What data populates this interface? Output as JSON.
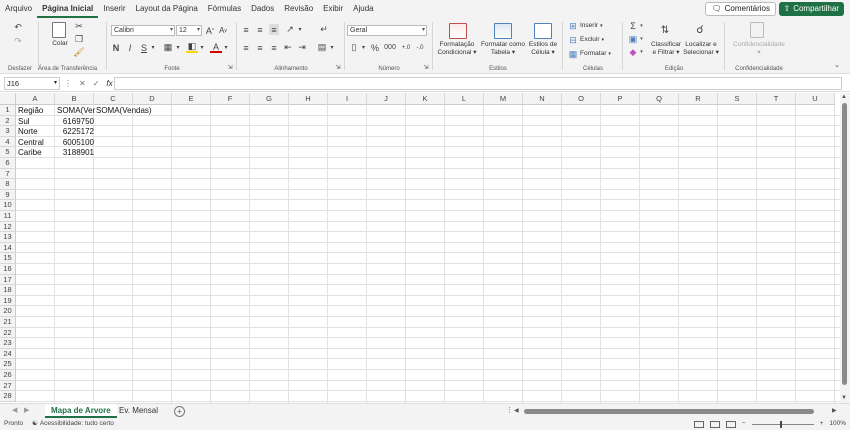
{
  "menu": {
    "items": [
      "Arquivo",
      "Página Inicial",
      "Inserir",
      "Layout da Página",
      "Fórmulas",
      "Dados",
      "Revisão",
      "Exibir",
      "Ajuda"
    ],
    "active_index": 1,
    "comments_label": "Comentários",
    "share_label": "Compartilhar"
  },
  "ribbon": {
    "undo_group_label": "Desfazer",
    "clipboard": {
      "paste_label": "Colar",
      "group_label": "Área de Transferência"
    },
    "font": {
      "family": "Calibri",
      "size": "12",
      "bold": "N",
      "italic": "I",
      "underline": "S",
      "group_label": "Fonte"
    },
    "alignment": {
      "group_label": "Alinhamento"
    },
    "number": {
      "format": "Geral",
      "group_label": "Número"
    },
    "styles": {
      "conditional_line1": "Formatação",
      "conditional_line2": "Condicional",
      "table_line1": "Formatar como",
      "table_line2": "Tabela",
      "cell_styles_line1": "Estilos de",
      "cell_styles_line2": "Célula",
      "group_label": "Estilos"
    },
    "cells": {
      "insert": "Inserir",
      "delete": "Excluir",
      "format": "Formatar",
      "group_label": "Células"
    },
    "editing": {
      "sort_line1": "Classificar",
      "sort_line2": "e Filtrar",
      "find_line1": "Localizar e",
      "find_line2": "Selecionar",
      "group_label": "Edição"
    },
    "sensitivity": {
      "label": "Confidencialidade",
      "group_label": "Confidencialidade"
    }
  },
  "formula_bar": {
    "name_box": "J16",
    "fx": "fx",
    "value": ""
  },
  "grid": {
    "columns": [
      "A",
      "B",
      "C",
      "D",
      "E",
      "F",
      "G",
      "H",
      "I",
      "J",
      "K",
      "L",
      "M",
      "N",
      "O",
      "P",
      "Q",
      "R",
      "S",
      "T",
      "U"
    ],
    "row_count": 28,
    "cells": {
      "A1": "Região",
      "B1": "SOMA(Ver",
      "C1": "SOMA(Vendas)",
      "A2": "Sul",
      "B2": "6169750",
      "A3": "Norte",
      "B3": "6225172",
      "A4": "Central",
      "B4": "6005100",
      "A5": "Caribe",
      "B5": "3188901"
    }
  },
  "sheets": {
    "tabs": [
      "Mapa de Arvore",
      "Ev. Mensal"
    ],
    "active_index": 0,
    "add_label": "+"
  },
  "status": {
    "ready": "Pronto",
    "accessibility": "Acessibilidade: tudo certo",
    "zoom": "100%"
  },
  "colors": {
    "accent": "#1e7145",
    "tab_active": "#1e7145"
  }
}
